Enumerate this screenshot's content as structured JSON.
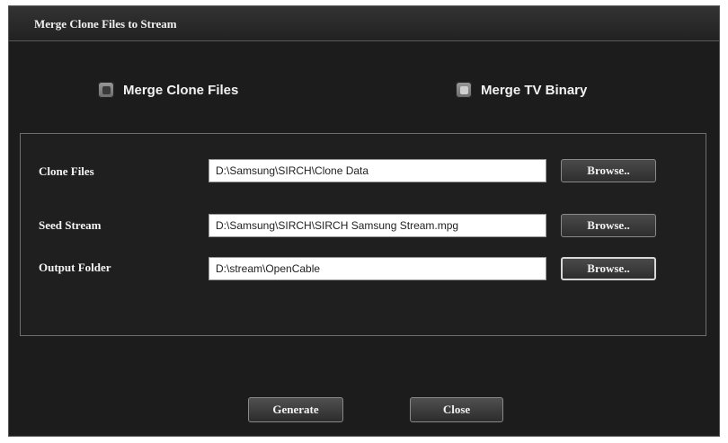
{
  "window": {
    "title": "Merge Clone Files to Stream"
  },
  "mode": {
    "options": [
      {
        "label": "Merge Clone Files",
        "selected": false
      },
      {
        "label": "Merge TV Binary",
        "selected": true
      }
    ]
  },
  "form": {
    "rows": [
      {
        "label": "Clone Files",
        "value": "D:\\Samsung\\SIRCH\\Clone Data",
        "button": "Browse.."
      },
      {
        "label": "Seed Stream",
        "value": "D:\\Samsung\\SIRCH\\SIRCH Samsung Stream.mpg",
        "button": "Browse.."
      },
      {
        "label": "Output Folder",
        "value": "D:\\stream\\OpenCable",
        "button": "Browse.."
      }
    ]
  },
  "actions": {
    "generate_label": "Generate",
    "close_label": "Close"
  },
  "colors": {
    "background": "#1c1c1c",
    "panel_border": "#6e6e6e",
    "text": "#f2f2f2"
  }
}
